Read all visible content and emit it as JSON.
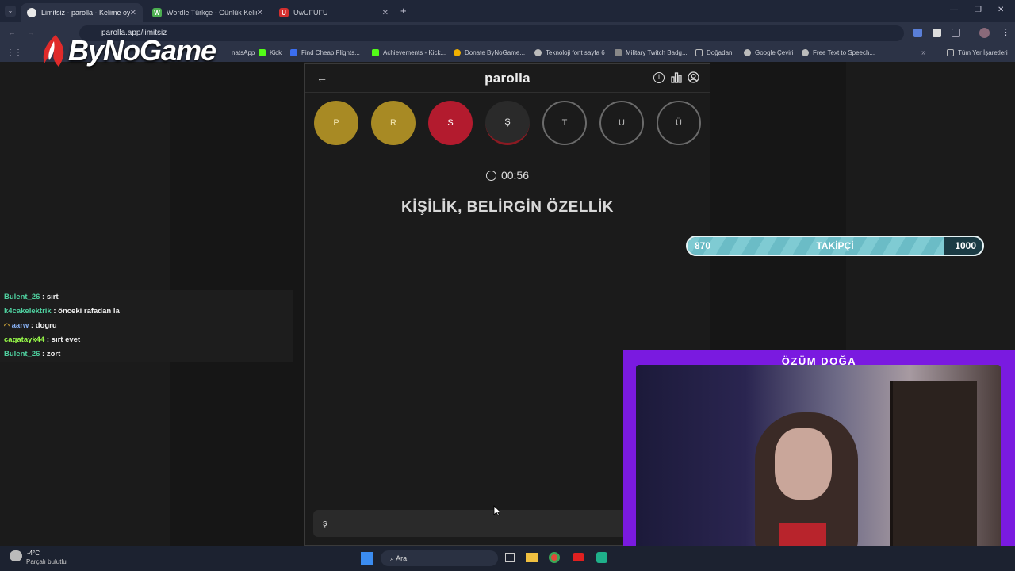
{
  "browser": {
    "tabs": [
      {
        "label": "Limitsiz - parolla - Kelime oyun...",
        "fav_color": "#e8e8e8",
        "fav_glyph": ""
      },
      {
        "label": "Wordle Türkçe - Günlük Kelime...",
        "fav_color": "#4caf50",
        "fav_glyph": "W"
      },
      {
        "label": "UwUFUFU",
        "fav_color": "#d32f2f",
        "fav_glyph": "U"
      }
    ],
    "new_tab": "+",
    "url": "parolla.app/limitsiz",
    "bookmarks": [
      {
        "label": "natsApp",
        "color": "#25d366"
      },
      {
        "label": "Kick",
        "color": "#53fc18"
      },
      {
        "label": "Find Cheap Flights...",
        "color": "#3b6ef0"
      },
      {
        "label": "Achievements - Kick...",
        "color": "#53fc18"
      },
      {
        "label": "Donate ByNoGame...",
        "color": "#f0b000"
      },
      {
        "label": "Teknoloji font sayfa 6",
        "color": "#cccccc"
      },
      {
        "label": "Military Twitch Badg...",
        "color": "#888888"
      },
      {
        "label": "Doğadan",
        "color": "#aaaaaa"
      },
      {
        "label": "Google Çeviri",
        "color": "#aaaaaa"
      },
      {
        "label": "Free Text to Speech...",
        "color": "#aaaaaa"
      },
      {
        "label": "Tüm Yer İşaretleri",
        "color": "#aaaaaa"
      }
    ]
  },
  "overlay": {
    "logo": "ByNoGame"
  },
  "game": {
    "title": "parolla",
    "letters": [
      {
        "char": "P",
        "state": "gold"
      },
      {
        "char": "R",
        "state": "gold"
      },
      {
        "char": "S",
        "state": "red"
      },
      {
        "char": "Ş",
        "state": "cur"
      },
      {
        "char": "T",
        "state": "empty"
      },
      {
        "char": "U",
        "state": "empty"
      },
      {
        "char": "Ü",
        "state": "empty"
      }
    ],
    "timer": "00:56",
    "clue": "KİŞİLİK, BELİRGİN ÖZELLİK",
    "answer_value": "ş"
  },
  "chat": [
    {
      "user": "Bulent_26",
      "color": "#4fd1a0",
      "msg": ": sırt"
    },
    {
      "user": "k4cakelektrik",
      "color": "#4fd1a0",
      "msg": ": önceki rafadan la"
    },
    {
      "user": "aarw",
      "color": "#8ab4f8",
      "msg": ": dogru",
      "badge": true
    },
    {
      "user": "cagatayk44",
      "color": "#9aff4a",
      "msg": ": sırt evet"
    },
    {
      "user": "Bulent_26",
      "color": "#4fd1a0",
      "msg": ": zort"
    }
  ],
  "follower_goal": {
    "current": "870",
    "label": "TAKİPÇİ",
    "target": "1000",
    "progress": 0.87
  },
  "webcam": {
    "name": "ÖZÜM DOĞA"
  },
  "taskbar": {
    "weather_temp": "-4°C",
    "weather_desc": "Parçalı bulutlu",
    "search": "Ara"
  }
}
